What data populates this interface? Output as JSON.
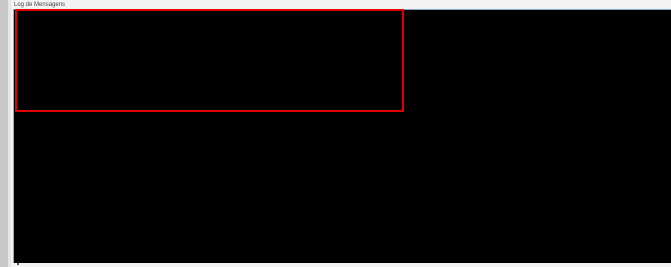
{
  "panel": {
    "label": "Log de Mensagens"
  },
  "log": {
    "content": ""
  },
  "colors": {
    "log_background": "#000000",
    "highlight_border": "#e00000",
    "frame_border": "#7fa7c9"
  }
}
